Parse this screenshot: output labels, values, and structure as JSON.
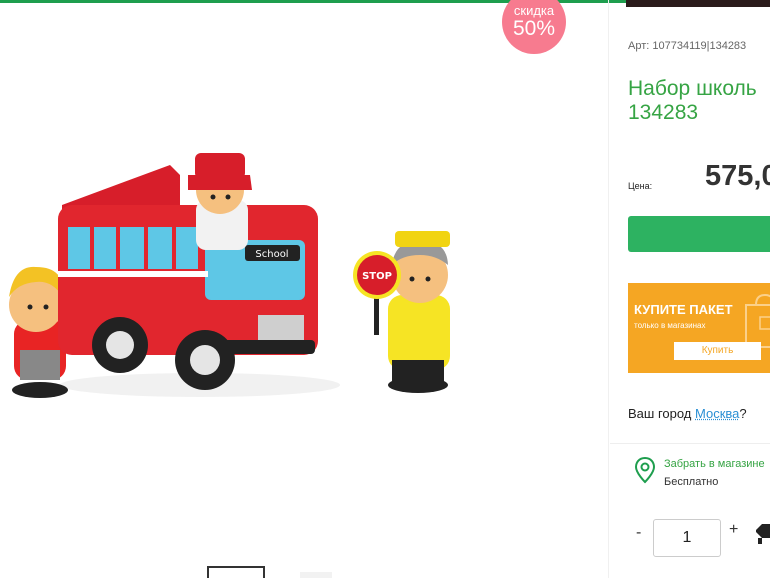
{
  "discount_badge": {
    "line1": "скидка",
    "line2": "50%"
  },
  "product": {
    "article": "Арт: 107734119|134283",
    "title_line1": "Набор школь",
    "title_line2": "134283",
    "price_label": "Цена:",
    "price": "575,0"
  },
  "promo_banner": {
    "headline": "КУПИТЕ ПАКЕТ",
    "subline": "только в магазинах",
    "button_label": "Купить"
  },
  "city": {
    "prefix": "Ваш город ",
    "name": "Москва",
    "suffix": "?"
  },
  "delivery": {
    "pickup_label": "Забрать в магазине",
    "pickup_cost": "Бесплатно"
  },
  "quantity": {
    "minus": "-",
    "value": "1",
    "plus": "+"
  },
  "image_text": {
    "bus_sign": "School",
    "stop_sign": "STOP"
  },
  "colors": {
    "brand_green": "#36a444",
    "button_green": "#2db261",
    "badge_pink": "#f77b8f",
    "banner_orange": "#f5a623",
    "link_blue": "#2a8fd4"
  },
  "icons": [
    "location-pin-icon",
    "favorite-icon"
  ]
}
